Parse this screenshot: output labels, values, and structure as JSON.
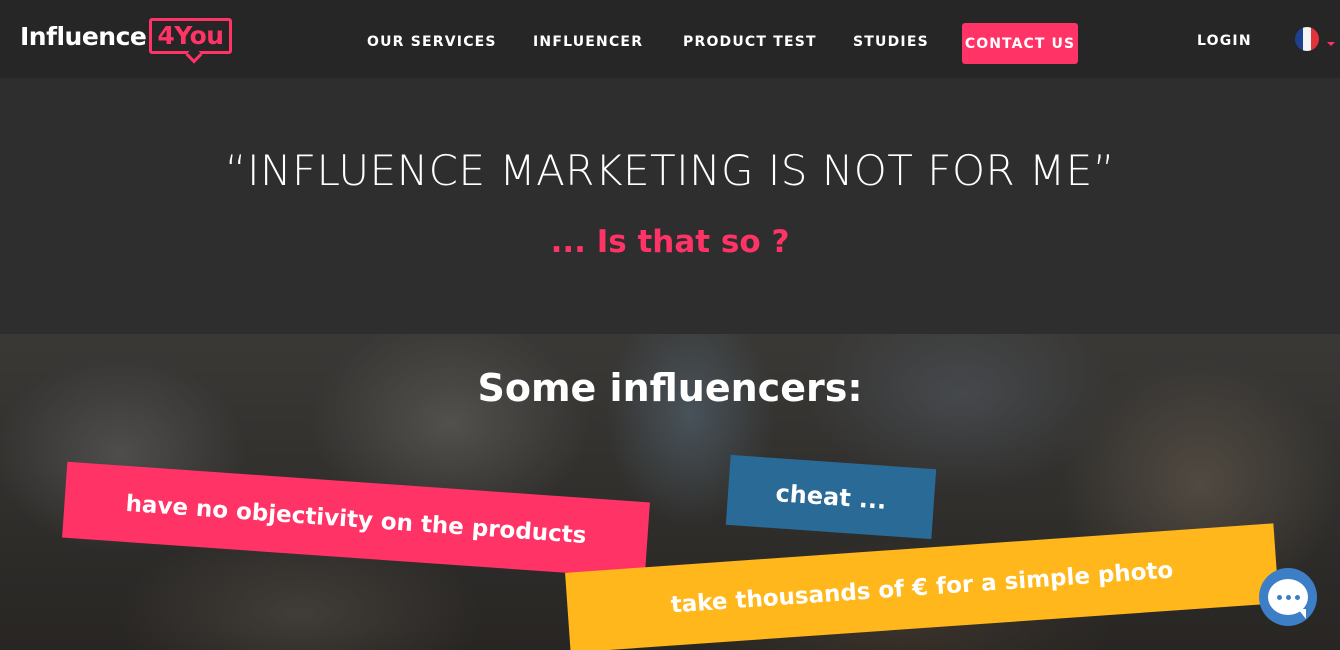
{
  "brand": {
    "name": "Influence",
    "badge": "4You",
    "accent": "#ff3366"
  },
  "nav": {
    "items": [
      {
        "label": "OUR SERVICES"
      },
      {
        "label": "INFLUENCER"
      },
      {
        "label": "PRODUCT TEST"
      },
      {
        "label": "STUDIES"
      }
    ],
    "contact_label": "CONTACT US",
    "login_label": "LOGIN",
    "language_flag": "fr-flag-icon"
  },
  "hero": {
    "title": "“INFLUENCE MARKETING IS NOT FOR ME”",
    "subtitle": "... Is that so ?"
  },
  "photo_section": {
    "title": "Some influencers:",
    "tags": [
      {
        "text": "have no objectivity on the products",
        "color": "#ff3366"
      },
      {
        "text": "cheat ...",
        "color": "#2a6a97"
      },
      {
        "text": "take thousands of € for a simple photo",
        "color": "#ffb71b"
      }
    ]
  },
  "chat_widget": {
    "icon": "chat-bubble-icon",
    "color": "#3d7fc6"
  }
}
